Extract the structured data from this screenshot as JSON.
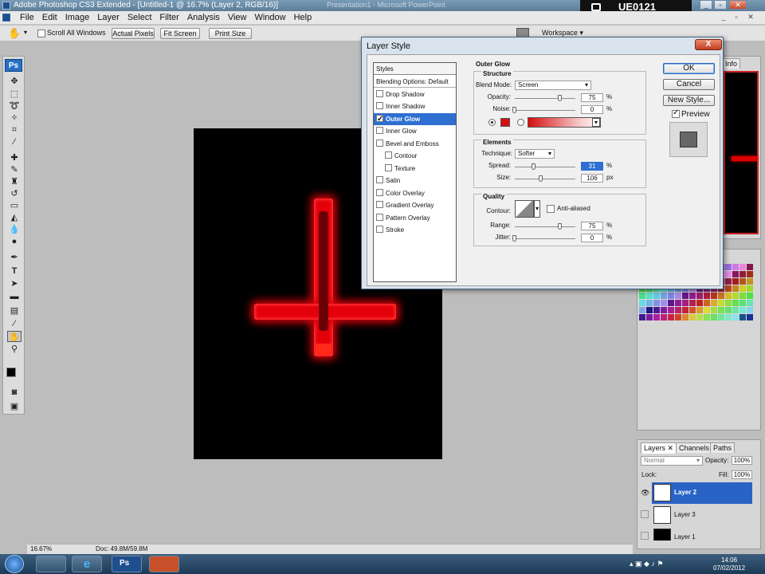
{
  "window": {
    "title": "Adobe Photoshop CS3 Extended - [Untitled-1 @ 16.7% (Layer 2, RGB/16)]",
    "background_title": "Presentation1 - Microsoft PowerPoint",
    "user_box": "UE0121"
  },
  "menu": [
    "File",
    "Edit",
    "Image",
    "Layer",
    "Select",
    "Filter",
    "Analysis",
    "View",
    "Window",
    "Help"
  ],
  "options_bar": {
    "scroll_all_windows": "Scroll All Windows",
    "actual_pixels": "Actual Pixels",
    "fit_screen": "Fit Screen",
    "print_size": "Print Size",
    "workspace": "Workspace"
  },
  "toolbox": {
    "logo": "Ps"
  },
  "status_bar": {
    "zoom": "16.67%",
    "doc": "Doc: 49.8M/59.8M"
  },
  "right_top_panel": {
    "tab": "Info"
  },
  "layers_panel": {
    "tabs": [
      "Layers",
      "Channels",
      "Paths"
    ],
    "blend_mode": "Normal",
    "opacity_label": "Opacity:",
    "opacity_value": "100%",
    "lock_label": "Lock:",
    "fill_label": "Fill:",
    "fill_value": "100%",
    "layers": [
      {
        "name": "Layer 2",
        "selected": true
      },
      {
        "name": "Layer 3",
        "selected": false
      },
      {
        "name": "Layer 1",
        "selected": false
      }
    ]
  },
  "dialog": {
    "title": "Layer Style",
    "close": "X",
    "styles_header": "Styles",
    "styles": [
      {
        "label": "Blending Options: Default",
        "checkbox": false,
        "checked": false,
        "selected": false,
        "indent": false
      },
      {
        "label": "Drop Shadow",
        "checkbox": true,
        "checked": false,
        "selected": false,
        "indent": false
      },
      {
        "label": "Inner Shadow",
        "checkbox": true,
        "checked": false,
        "selected": false,
        "indent": false
      },
      {
        "label": "Outer Glow",
        "checkbox": true,
        "checked": true,
        "selected": true,
        "indent": false
      },
      {
        "label": "Inner Glow",
        "checkbox": true,
        "checked": false,
        "selected": false,
        "indent": false
      },
      {
        "label": "Bevel and Emboss",
        "checkbox": true,
        "checked": false,
        "selected": false,
        "indent": false
      },
      {
        "label": "Contour",
        "checkbox": true,
        "checked": false,
        "selected": false,
        "indent": true
      },
      {
        "label": "Texture",
        "checkbox": true,
        "checked": false,
        "selected": false,
        "indent": true
      },
      {
        "label": "Satin",
        "checkbox": true,
        "checked": false,
        "selected": false,
        "indent": false
      },
      {
        "label": "Color Overlay",
        "checkbox": true,
        "checked": false,
        "selected": false,
        "indent": false
      },
      {
        "label": "Gradient Overlay",
        "checkbox": true,
        "checked": false,
        "selected": false,
        "indent": false
      },
      {
        "label": "Pattern Overlay",
        "checkbox": true,
        "checked": false,
        "selected": false,
        "indent": false
      },
      {
        "label": "Stroke",
        "checkbox": true,
        "checked": false,
        "selected": false,
        "indent": false
      }
    ],
    "outer_glow": {
      "heading": "Outer Glow",
      "structure": {
        "heading": "Structure",
        "blend_mode_label": "Blend Mode:",
        "blend_mode": "Screen",
        "opacity_label": "Opacity:",
        "opacity": "75",
        "opacity_fraction": 0.75,
        "noise_label": "Noise:",
        "noise": "0",
        "noise_fraction": 0.0,
        "unit": "%",
        "glow_color": "#d40f0f"
      },
      "elements": {
        "heading": "Elements",
        "technique_label": "Technique:",
        "technique": "Softer",
        "spread_label": "Spread:",
        "spread": "31",
        "spread_fraction": 0.31,
        "size_label": "Size:",
        "size": "106",
        "size_fraction": 0.43,
        "spread_unit": "%",
        "size_unit": "px"
      },
      "quality": {
        "heading": "Quality",
        "contour_label": "Contour:",
        "anti_aliased": "Anti-aliased",
        "range_label": "Range:",
        "range": "75",
        "range_fraction": 0.75,
        "jitter_label": "Jitter:",
        "jitter": "0",
        "jitter_fraction": 0.0,
        "unit": "%"
      }
    },
    "buttons": {
      "ok": "OK",
      "cancel": "Cancel",
      "new_style": "New Style..."
    },
    "preview_label": "Preview"
  },
  "taskbar": {
    "time": "14:06",
    "date": "07/02/2012",
    "ps_label": "Ps"
  },
  "colors": {
    "accent": "#2e6fd1",
    "glow": "#e4000b"
  }
}
